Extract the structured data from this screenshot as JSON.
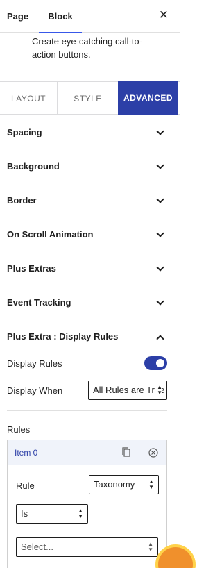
{
  "header": {
    "tabs": [
      "Page",
      "Block"
    ],
    "active_tab": "Block",
    "close_icon": "close-icon"
  },
  "block": {
    "description": "Create eye-catching call-to-action buttons."
  },
  "inspector_tabs": {
    "layout": "LAYOUT",
    "style": "STYLE",
    "advanced": "ADVANCED",
    "active": "ADVANCED",
    "active_color": "#2c3fa7"
  },
  "panels": [
    {
      "label": "Spacing",
      "open": false
    },
    {
      "label": "Background",
      "open": false
    },
    {
      "label": "Border",
      "open": false
    },
    {
      "label": "On Scroll Animation",
      "open": false
    },
    {
      "label": "Plus Extras",
      "open": false
    },
    {
      "label": "Event Tracking",
      "open": false
    },
    {
      "label": "Plus Extra : Display Rules",
      "open": true
    }
  ],
  "display_rules": {
    "toggle_label": "Display Rules",
    "toggle_on": true,
    "display_when_label": "Display When",
    "display_when_value": "All Rules are True",
    "rules_label": "Rules",
    "item": {
      "title": "Item 0",
      "rule_label": "Rule",
      "rule_value": "Taxonomy",
      "operator_value": "Is",
      "term_placeholder": "Select..."
    }
  },
  "colors": {
    "accent": "#2c3fa7",
    "tab_underline": "#3858e9",
    "item_header_bg": "#f0f3fa",
    "badge": "#f0902c"
  }
}
